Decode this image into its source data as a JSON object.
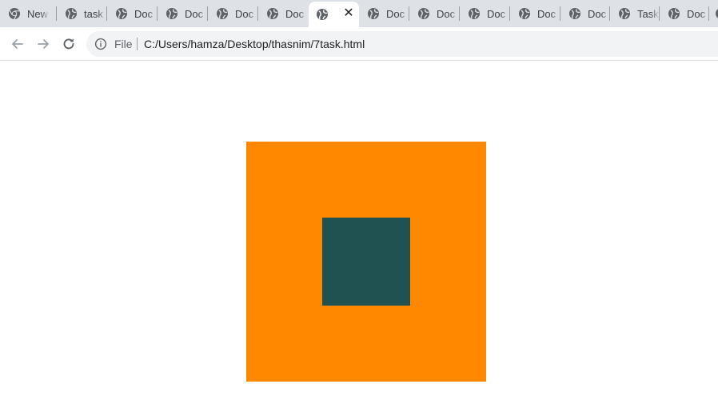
{
  "tabs": [
    {
      "label": "New",
      "icon": "chrome-icon"
    },
    {
      "label": "task",
      "icon": "globe-icon"
    },
    {
      "label": "Doc",
      "icon": "globe-icon"
    },
    {
      "label": "Doc",
      "icon": "globe-icon"
    },
    {
      "label": "Doc",
      "icon": "globe-icon"
    },
    {
      "label": "Doc",
      "icon": "globe-icon"
    },
    {
      "label": "",
      "icon": "globe-icon",
      "active": true,
      "close": "✕"
    },
    {
      "label": "Doc",
      "icon": "globe-icon"
    },
    {
      "label": "Doc",
      "icon": "globe-icon"
    },
    {
      "label": "Doc",
      "icon": "globe-icon"
    },
    {
      "label": "Doc",
      "icon": "globe-icon"
    },
    {
      "label": "Doc",
      "icon": "globe-icon"
    },
    {
      "label": "Task",
      "icon": "globe-icon"
    },
    {
      "label": "Doc",
      "icon": "globe-icon"
    }
  ],
  "toolbar": {
    "scheme_label": "File",
    "url": "C:/Users/hamza/Desktop/thasnim/7task.html"
  },
  "page": {
    "outer_color": "#ff8800",
    "inner_color": "#215252"
  }
}
